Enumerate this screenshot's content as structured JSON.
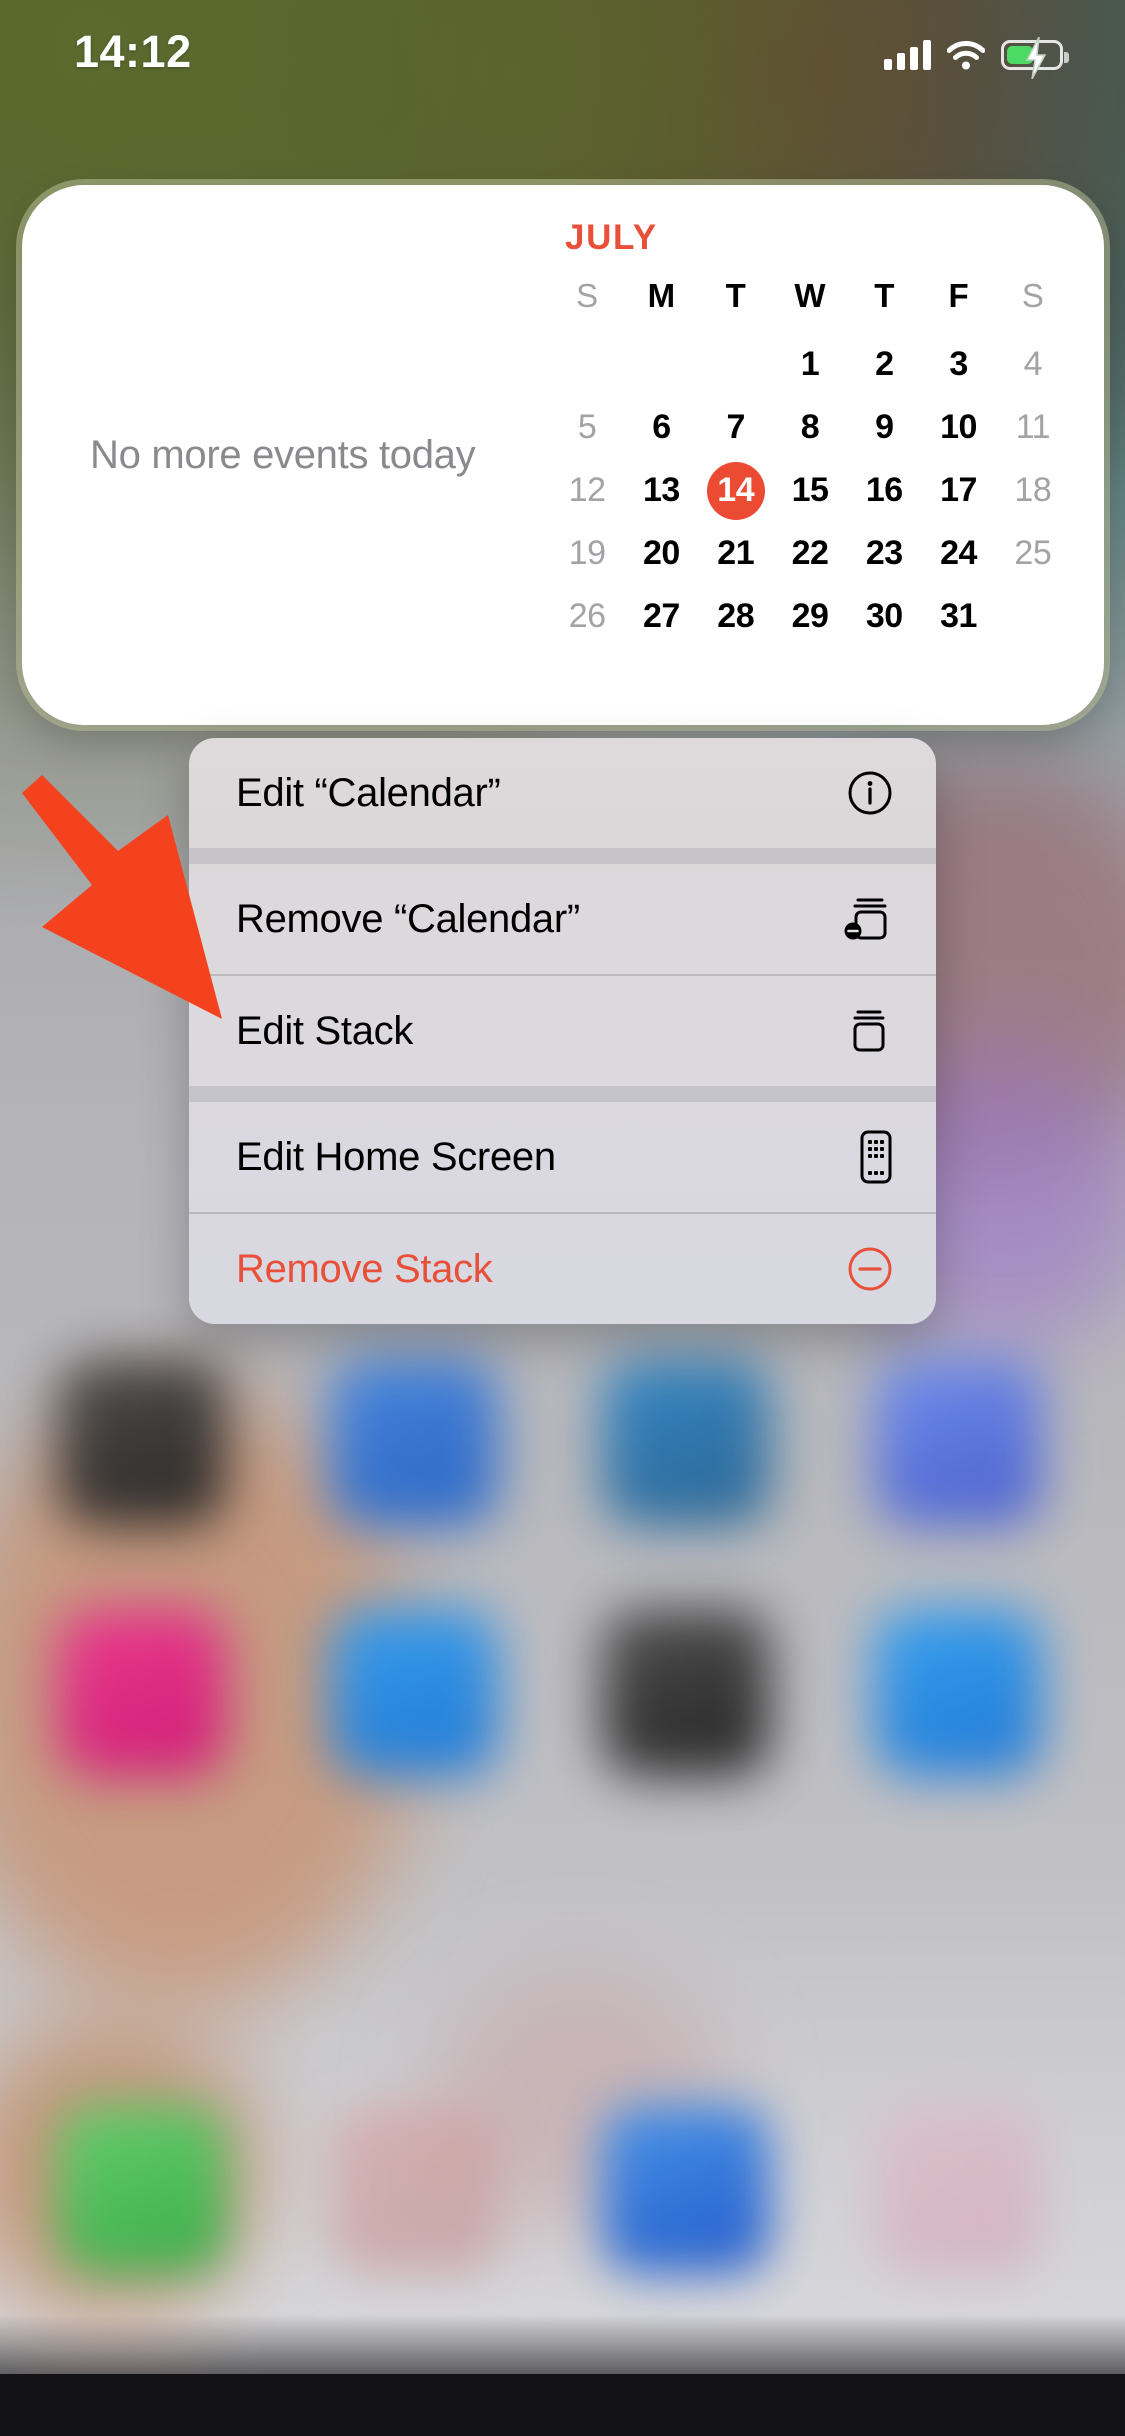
{
  "status_bar": {
    "time": "14:12",
    "cellular_icon": "cellular-bars-icon",
    "wifi_icon": "wifi-icon",
    "battery_icon": "battery-charging-icon",
    "battery_color": "#4cd964"
  },
  "widget": {
    "name": "Calendar",
    "events_text": "No more events today",
    "month": "JULY",
    "accent_color": "#eb4b33",
    "day_headers": [
      {
        "label": "S",
        "weekend": true
      },
      {
        "label": "M",
        "weekend": false
      },
      {
        "label": "T",
        "weekend": false
      },
      {
        "label": "W",
        "weekend": false
      },
      {
        "label": "T",
        "weekend": false
      },
      {
        "label": "F",
        "weekend": false
      },
      {
        "label": "S",
        "weekend": true
      }
    ],
    "today": "14",
    "weeks": [
      [
        "",
        "",
        "",
        "1",
        "2",
        "3",
        "4"
      ],
      [
        "5",
        "6",
        "7",
        "8",
        "9",
        "10",
        "11"
      ],
      [
        "12",
        "13",
        "14",
        "15",
        "16",
        "17",
        "18"
      ],
      [
        "19",
        "20",
        "21",
        "22",
        "23",
        "24",
        "25"
      ],
      [
        "26",
        "27",
        "28",
        "29",
        "30",
        "31",
        ""
      ]
    ]
  },
  "context_menu": {
    "items": [
      {
        "label": "Edit “Calendar”",
        "icon": "info-circle-icon",
        "destructive": false
      },
      {
        "label": "Remove “Calendar”",
        "icon": "remove-from-stack-icon",
        "destructive": false
      },
      {
        "label": "Edit Stack",
        "icon": "stack-icon",
        "destructive": false
      },
      {
        "label": "Edit Home Screen",
        "icon": "home-screen-icon",
        "destructive": false
      },
      {
        "label": "Remove Stack",
        "icon": "minus-circle-icon",
        "destructive": true
      }
    ]
  },
  "annotation": {
    "arrow_color": "#f4421e",
    "points_to": "Edit Stack"
  },
  "home_screen": {
    "icon_rows": [
      [
        {
          "color": "#3b3b3b"
        },
        {
          "color": "#2f6fd0"
        },
        {
          "color": "#2d84c4"
        },
        {
          "color": "#4a68d8"
        }
      ],
      [
        {
          "color": "#e0218a"
        },
        {
          "color": "#1f8ef1"
        },
        {
          "color": "#2b2b2b"
        },
        {
          "color": "#1f8ef1"
        }
      ]
    ],
    "dock": [
      {
        "color": "#3fbf52"
      },
      {
        "color": "#c98e8e"
      },
      {
        "color": "#1f6fd8"
      },
      {
        "color": "#d4a0ae"
      }
    ]
  }
}
